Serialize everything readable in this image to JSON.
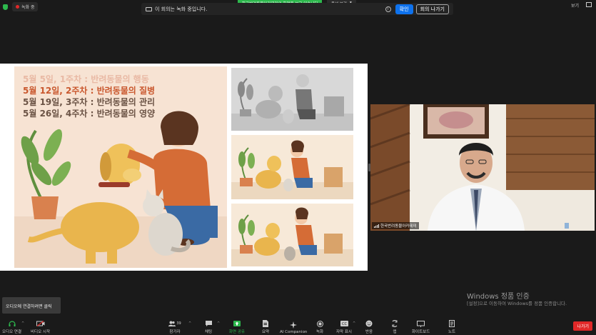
{
  "status": {
    "recording_label": "녹화 중"
  },
  "share_banner": "한국반려동물아카데미의 화면을 보고 있습니다",
  "view_options": "옵션 보기",
  "recording_bar": {
    "message": "이 회의는 녹화 중입니다.",
    "confirm": "확인",
    "leave": "회의 나가기"
  },
  "top_right": {
    "view": "보기"
  },
  "slide": {
    "agenda": [
      {
        "text": "5월  5일, 1주차 : 반려동물의 행동"
      },
      {
        "text": "5월 12일, 2주차 : 반려동물의 질병"
      },
      {
        "text": "5월 19일, 3주차 : 반려동물의 관리"
      },
      {
        "text": "5월 26일, 4주차 : 반려동물의 영양"
      }
    ]
  },
  "video": {
    "name": "한국반려동물아카데미"
  },
  "watermark": {
    "title": "Windows 정품 인증",
    "subtitle": "[설정]으로 이동하여 Windows를 정품 인증합니다."
  },
  "tooltip": "오디오에 연결하려면 클릭",
  "toolbar": {
    "audio": "오디오 연결",
    "video": "비디오 시작",
    "participants": "참가자",
    "participants_count": "39",
    "chat": "채팅",
    "share": "화면 공유",
    "summary": "요약",
    "ai": "AI Companion",
    "record": "녹화",
    "captions": "자막 표시",
    "reactions": "반응",
    "apps": "앱",
    "whiteboard": "화이트보드",
    "notes": "노트",
    "leave": "나가기"
  },
  "colors": {
    "accent_blue": "#0e72ed",
    "share_green": "#2db84d",
    "leave_red": "#e02828"
  }
}
